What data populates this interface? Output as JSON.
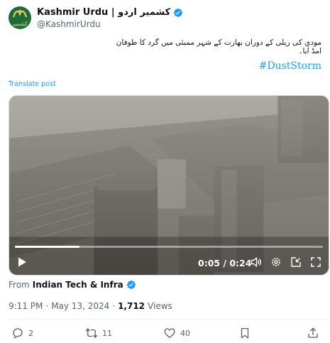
{
  "author": {
    "display_name": "Kashmir Urdu | کشمیر اردو",
    "handle": "@KashmirUrdu",
    "avatar_text": "کشمیر"
  },
  "post": {
    "text": "مودی کی ریلی کے دوران بھارت کے شہر ممبئی میں گرد کا طوفان امڈ آیا۔",
    "hashtag": "DustStorm#",
    "translate_label": "Translate post"
  },
  "video": {
    "current_time": "0:05",
    "duration": "0:24",
    "time_display": "0:05 / 0:24",
    "progress_fraction": 0.21
  },
  "source": {
    "label": "From",
    "name": "Indian Tech & Infra"
  },
  "meta": {
    "time": "9:11 PM",
    "separator": "·",
    "date": "May 13, 2024",
    "views_count": "1,712",
    "views_label": "Views"
  },
  "actions": {
    "replies": "2",
    "reposts": "11",
    "likes": "40"
  },
  "colors": {
    "accent": "#1d9bf0",
    "text": "#0f1419",
    "secondary": "#536471"
  }
}
